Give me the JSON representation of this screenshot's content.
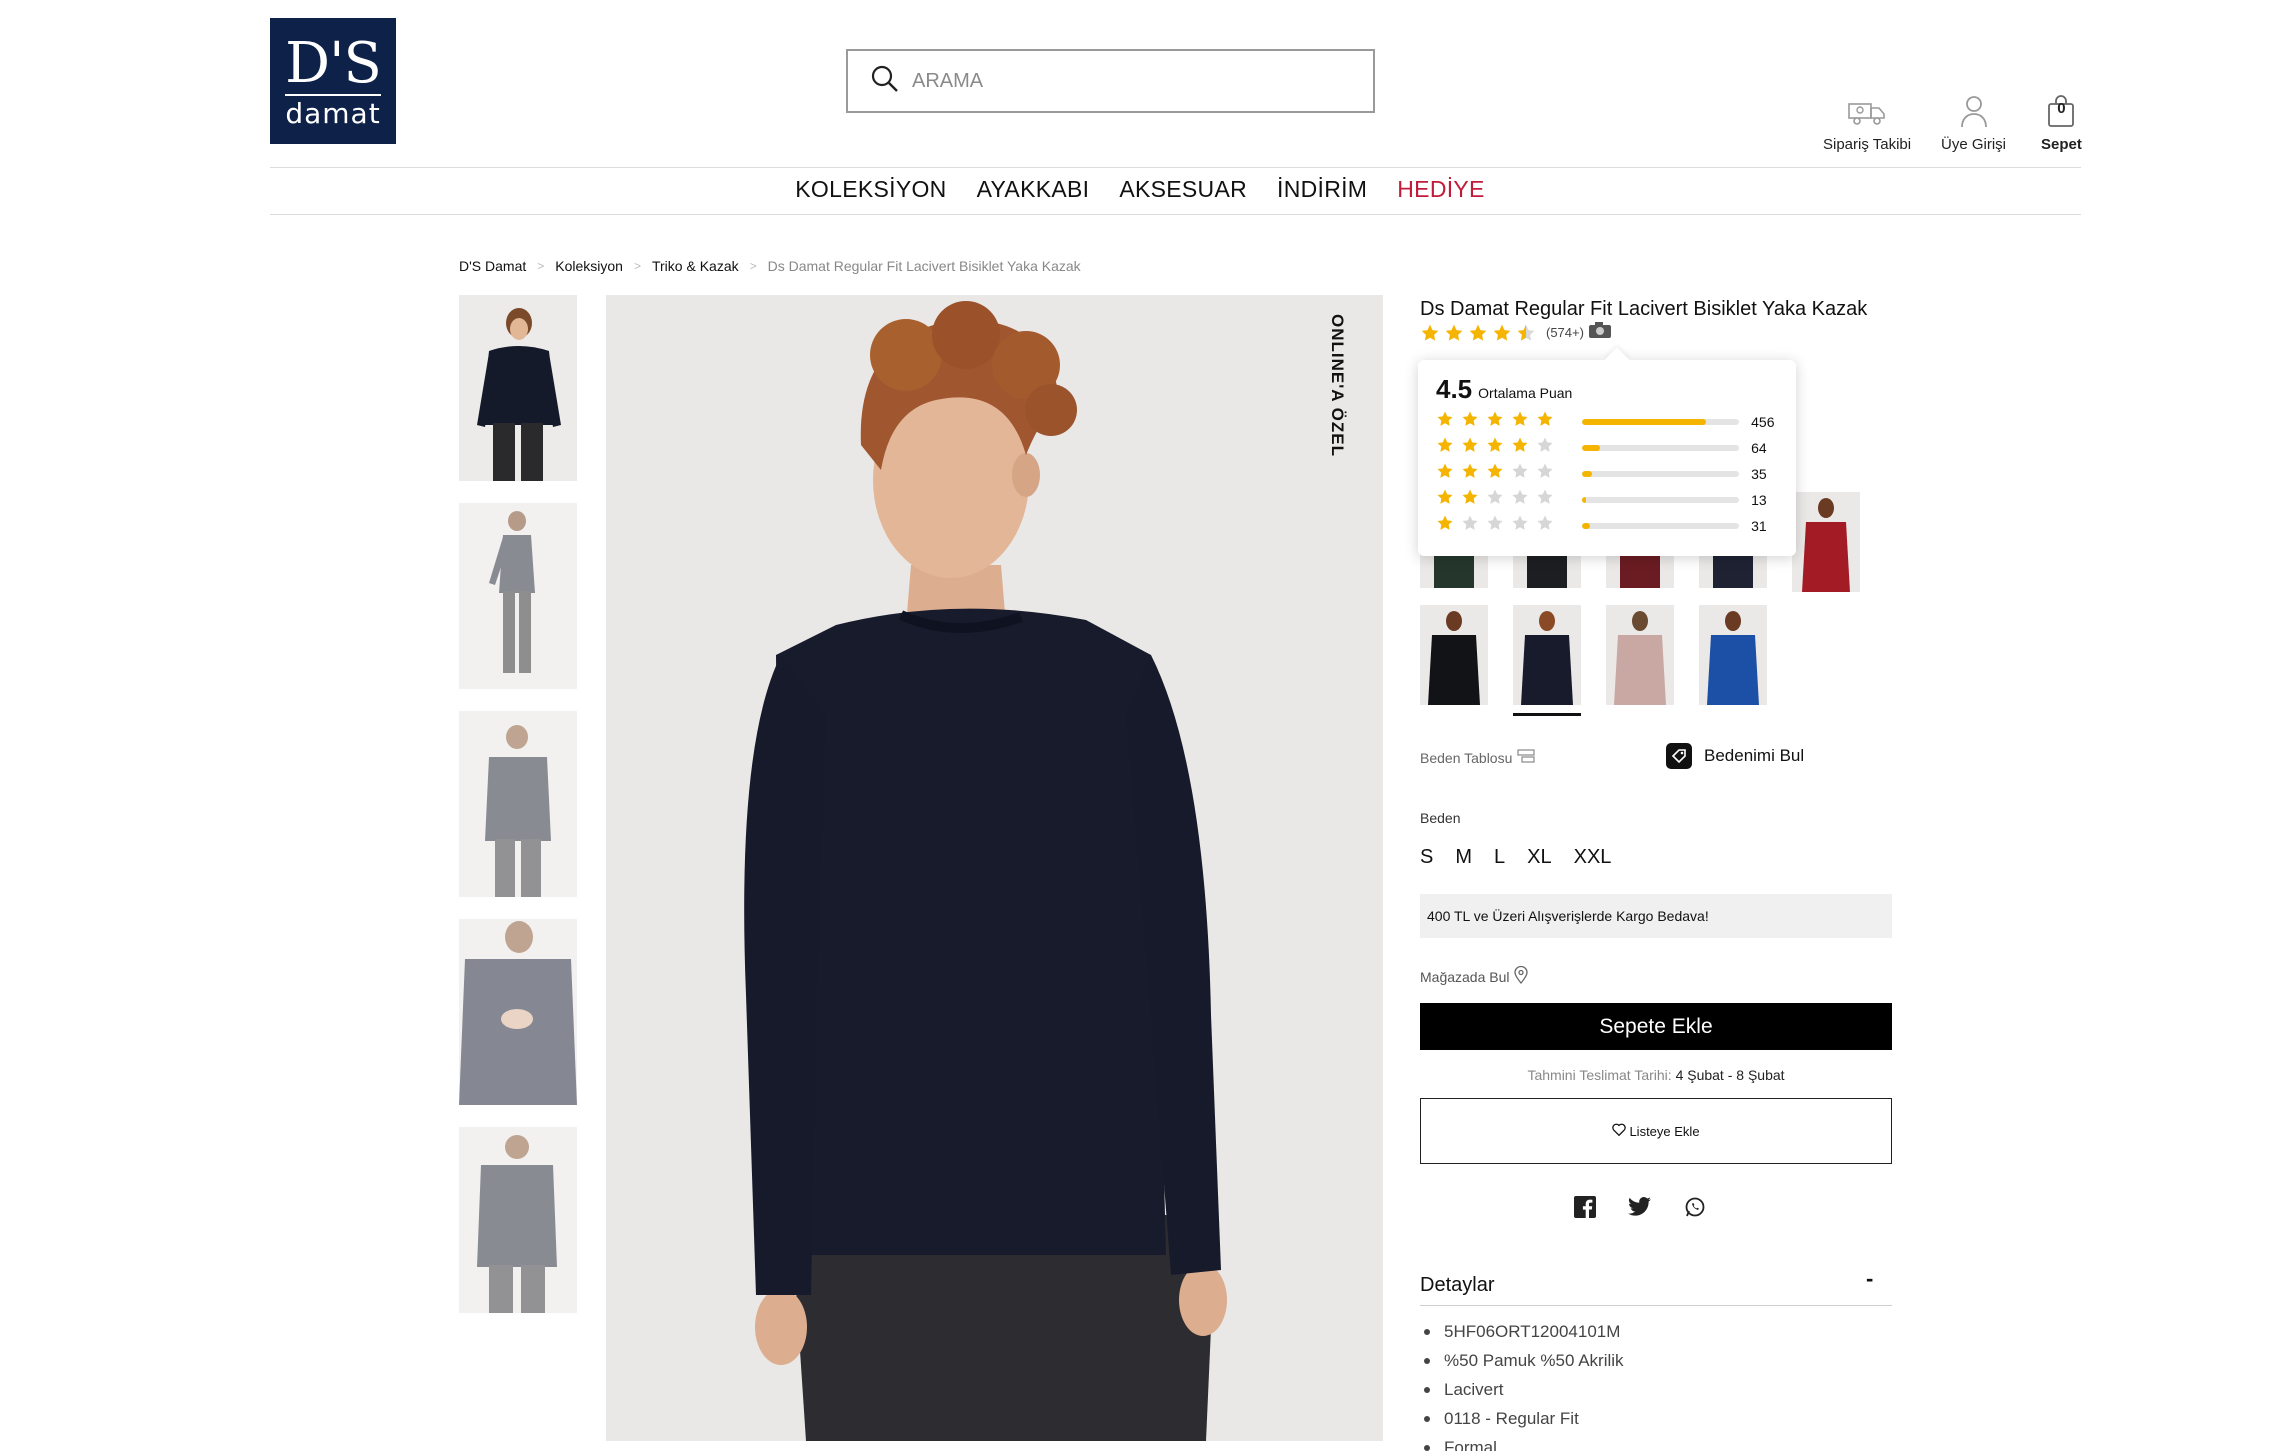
{
  "brand": {
    "logo_line1": "D'S",
    "logo_line2": "damat"
  },
  "search": {
    "placeholder": "ARAMA"
  },
  "header_actions": {
    "order_tracking": "Sipariş Takibi",
    "login": "Üye Girişi",
    "cart": "Sepet",
    "cart_count": "0"
  },
  "nav": {
    "items": [
      "KOLEKSİYON",
      "AYAKKABI",
      "AKSESUAR",
      "İNDİRİM",
      "HEDİYE"
    ],
    "highlight_color": "#c21a3a"
  },
  "breadcrumb": {
    "items": [
      "D'S Damat",
      "Koleksiyon",
      "Triko & Kazak",
      "Ds Damat Regular Fit Lacivert Bisiklet Yaka Kazak"
    ],
    "separator": ">"
  },
  "gallery": {
    "badge": "ONLINE'A ÖZEL"
  },
  "product": {
    "title": "Ds Damat Regular Fit Lacivert Bisiklet Yaka Kazak",
    "rating_value": 4.5,
    "review_count": "(574+)"
  },
  "rating_popup": {
    "average": "4.5",
    "average_label": "Ortalama Puan",
    "rows": [
      {
        "stars": 5,
        "count": "456",
        "fill": 0.79
      },
      {
        "stars": 4,
        "count": "64",
        "fill": 0.11
      },
      {
        "stars": 3,
        "count": "35",
        "fill": 0.06
      },
      {
        "stars": 2,
        "count": "13",
        "fill": 0.02
      },
      {
        "stars": 1,
        "count": "31",
        "fill": 0.05
      }
    ],
    "star_color": "#f4b400"
  },
  "size": {
    "chart_label": "Beden Tablosu",
    "find_size_label": "Bedenimi Bul",
    "label": "Beden",
    "options": [
      "S",
      "M",
      "L",
      "XL",
      "XXL"
    ]
  },
  "cargo_notice": "400 TL ve Üzeri Alışverişlerde Kargo Bedava!",
  "store_finder": "Mağazada Bul",
  "add_to_cart": "Sepete Ekle",
  "delivery": {
    "label": "Tahmini Teslimat Tarihi:",
    "range": "4 Şubat - 8 Şubat"
  },
  "wishlist": "Listeye Ekle",
  "social": [
    "facebook-icon",
    "twitter-icon",
    "whatsapp-icon"
  ],
  "details": {
    "title": "Detaylar",
    "toggle": "-",
    "items": [
      "5HF06ORT12004101M",
      "%50 Pamuk %50 Akrilik",
      "Lacivert",
      "0118 - Regular Fit",
      "Formal"
    ]
  }
}
